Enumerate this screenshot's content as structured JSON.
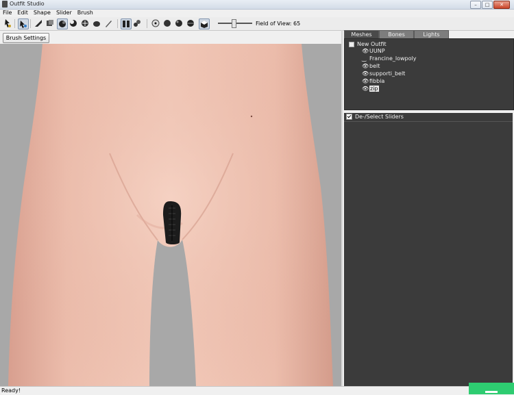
{
  "window": {
    "title": "Outfit Studio"
  },
  "menu": {
    "items": [
      "File",
      "Edit",
      "Shape",
      "Slider",
      "Brush"
    ]
  },
  "toolbar": {
    "fov_label": "Field of View: 65",
    "fov_value": 65
  },
  "brush_settings_label": "Brush Settings >>",
  "tabs": [
    "Meshes",
    "Bones",
    "Lights"
  ],
  "meshes": {
    "root": "New Outfit",
    "items": [
      {
        "name": "UUNP",
        "visible": true
      },
      {
        "name": "Francine_lowpoly",
        "visible": false
      },
      {
        "name": "belt",
        "visible": true
      },
      {
        "name": "supporti_belt",
        "visible": true
      },
      {
        "name": "fibbia",
        "visible": true
      },
      {
        "name": "zip",
        "visible": true,
        "selected": true
      }
    ]
  },
  "sliders": {
    "select_label": "De-/Select Sliders"
  },
  "status": {
    "text": "Ready!"
  },
  "colors": {
    "panel": "#3b3b3b",
    "skin": "#eab7a4",
    "accent_green": "#2ecc71"
  }
}
